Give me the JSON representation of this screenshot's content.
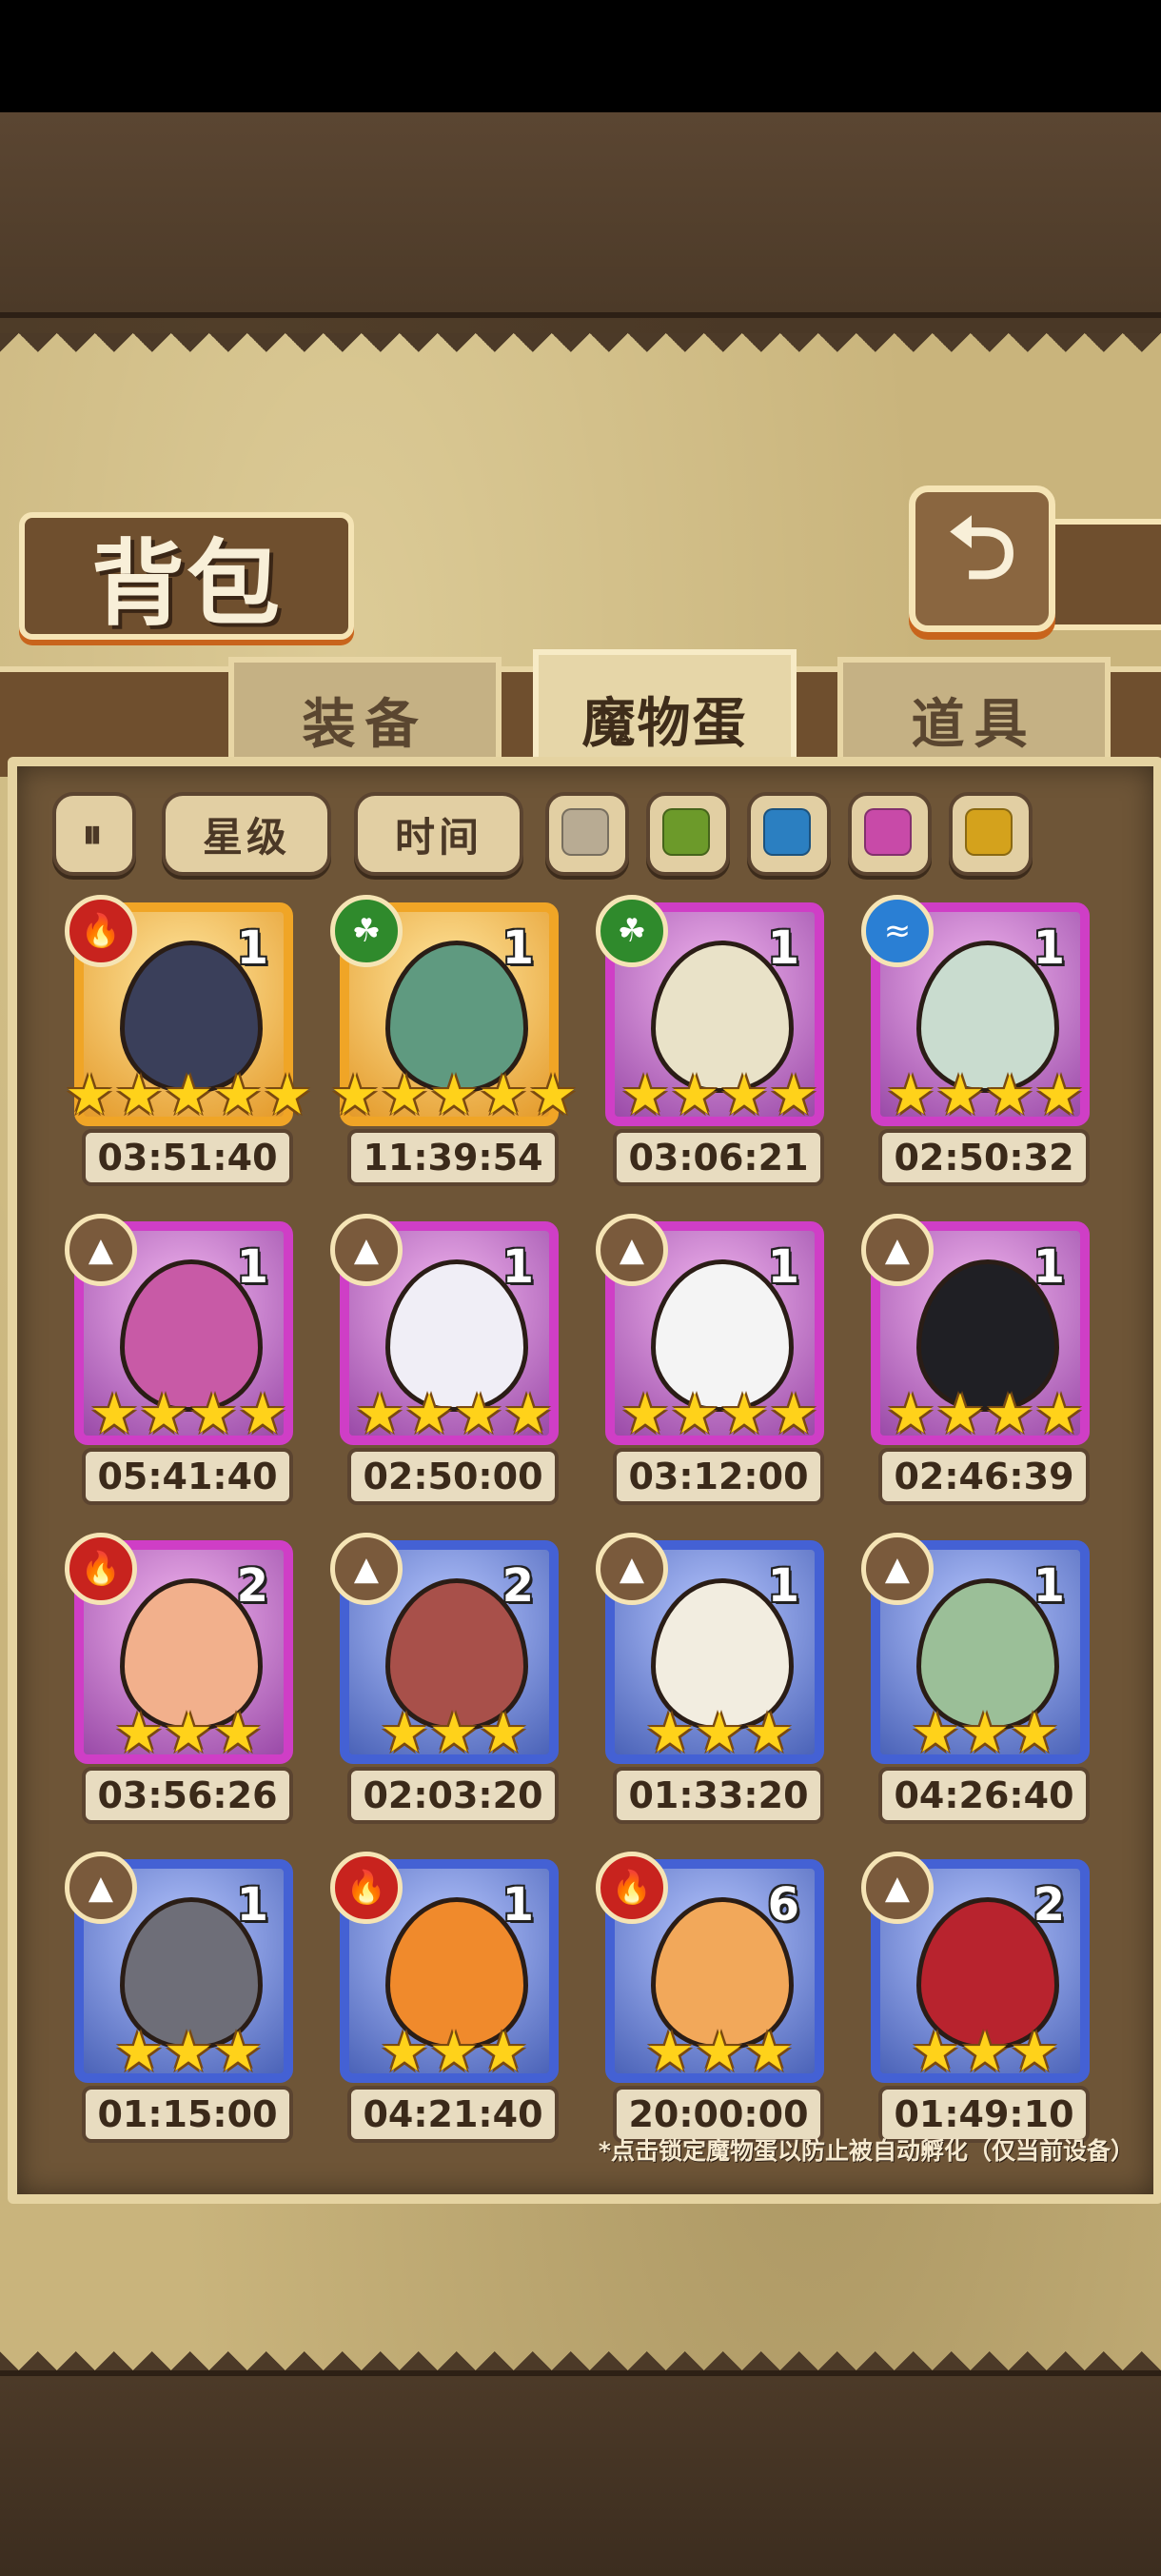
{
  "header": {
    "title": "背包",
    "back_icon": "back-arrow-icon"
  },
  "tabs": [
    {
      "label": "装备",
      "active": false
    },
    {
      "label": "魔物蛋",
      "active": true
    },
    {
      "label": "道具",
      "active": false
    }
  ],
  "filters": {
    "sort_icon": "sort-toggle-icon",
    "star_label": "星级",
    "time_label": "时间",
    "rarity_colors": [
      "#b8ab93",
      "#6c9a2a",
      "#2b7fc1",
      "#c84aa8",
      "#d4a21c"
    ]
  },
  "eggs": [
    {
      "count": "1",
      "timer": "03:51:40",
      "element": "fire",
      "stars": 5,
      "rarity": "gold",
      "egg_color": "#3a3f5a"
    },
    {
      "count": "1",
      "timer": "11:39:54",
      "element": "leaf",
      "stars": 5,
      "rarity": "gold",
      "egg_color": "#5f9a80"
    },
    {
      "count": "1",
      "timer": "03:06:21",
      "element": "leaf",
      "stars": 4,
      "rarity": "purple",
      "egg_color": "#e9e2c8"
    },
    {
      "count": "1",
      "timer": "02:50:32",
      "element": "water",
      "stars": 4,
      "rarity": "purple",
      "egg_color": "#c9dccf"
    },
    {
      "count": "1",
      "timer": "05:41:40",
      "element": "earth",
      "stars": 4,
      "rarity": "purple",
      "egg_color": "#c85aa6"
    },
    {
      "count": "1",
      "timer": "02:50:00",
      "element": "earth",
      "stars": 4,
      "rarity": "purple",
      "egg_color": "#f0eef6"
    },
    {
      "count": "1",
      "timer": "03:12:00",
      "element": "earth",
      "stars": 4,
      "rarity": "purple",
      "egg_color": "#f4f4f4"
    },
    {
      "count": "1",
      "timer": "02:46:39",
      "element": "earth",
      "stars": 4,
      "rarity": "purple",
      "egg_color": "#1f1f24"
    },
    {
      "count": "2",
      "timer": "03:56:26",
      "element": "fire",
      "stars": 3,
      "rarity": "purple",
      "egg_color": "#f2b08c"
    },
    {
      "count": "2",
      "timer": "02:03:20",
      "element": "earth",
      "stars": 3,
      "rarity": "blue",
      "egg_color": "#a8504a"
    },
    {
      "count": "1",
      "timer": "01:33:20",
      "element": "earth",
      "stars": 3,
      "rarity": "blue",
      "egg_color": "#f2ede0"
    },
    {
      "count": "1",
      "timer": "04:26:40",
      "element": "earth",
      "stars": 3,
      "rarity": "blue",
      "egg_color": "#9bbf98"
    },
    {
      "count": "1",
      "timer": "01:15:00",
      "element": "earth",
      "stars": 3,
      "rarity": "blue",
      "egg_color": "#6e6e78"
    },
    {
      "count": "1",
      "timer": "04:21:40",
      "element": "fire",
      "stars": 3,
      "rarity": "blue",
      "egg_color": "#f08a2c"
    },
    {
      "count": "6",
      "timer": "20:00:00",
      "element": "fire",
      "stars": 3,
      "rarity": "blue",
      "egg_color": "#f2a85a"
    },
    {
      "count": "2",
      "timer": "01:49:10",
      "element": "earth",
      "stars": 3,
      "rarity": "blue",
      "egg_color": "#b8232e"
    }
  ],
  "footer_note": "*点击锁定魔物蛋以防止被自动孵化（仅当前设备）"
}
